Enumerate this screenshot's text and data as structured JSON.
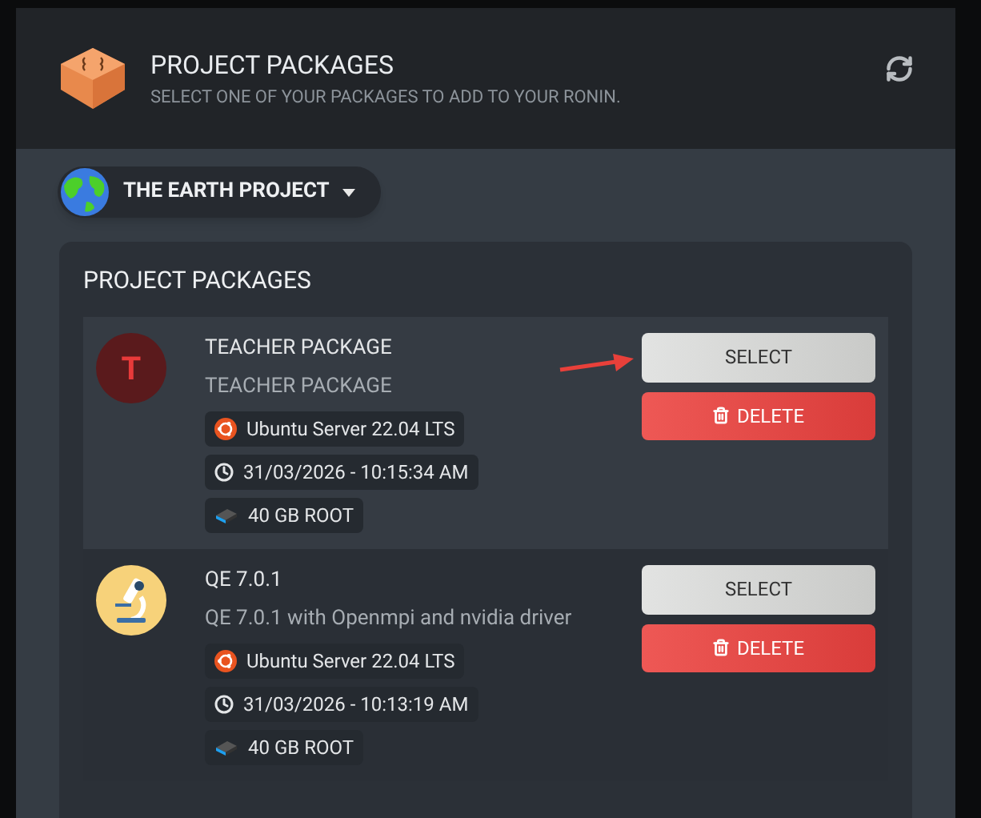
{
  "header": {
    "title": "PROJECT PACKAGES",
    "subtitle": "SELECT ONE OF YOUR PACKAGES TO ADD TO YOUR RONIN."
  },
  "project_selector": {
    "label": "THE EARTH PROJECT"
  },
  "panel": {
    "title": "PROJECT PACKAGES"
  },
  "packages": [
    {
      "avatar": {
        "kind": "letter",
        "letter": "T"
      },
      "name": "TEACHER PACKAGE",
      "description": "TEACHER PACKAGE",
      "os": "Ubuntu Server 22.04 LTS",
      "date": "31/03/2026 - 10:15:34 AM",
      "storage": "40 GB ROOT",
      "select": "SELECT",
      "delete": "DELETE",
      "pointed": true
    },
    {
      "avatar": {
        "kind": "microscope"
      },
      "name": "QE 7.0.1",
      "description": "QE 7.0.1 with Openmpi and nvidia driver",
      "os": "Ubuntu Server 22.04 LTS",
      "date": "31/03/2026 - 10:13:19 AM",
      "storage": "40 GB ROOT",
      "select": "SELECT",
      "delete": "DELETE",
      "pointed": false
    }
  ]
}
